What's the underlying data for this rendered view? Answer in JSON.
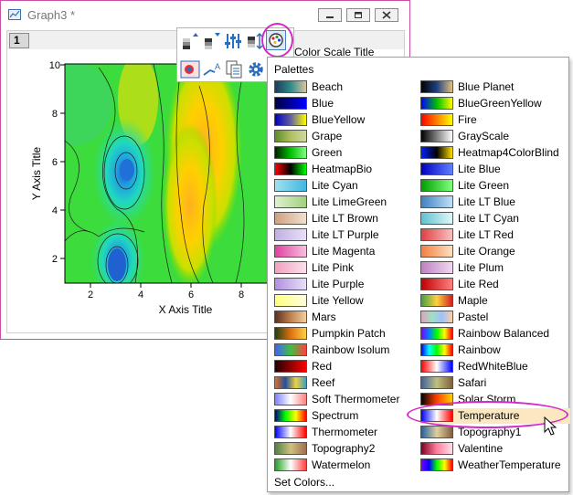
{
  "window": {
    "title": "Graph3 *",
    "layer_tab": "1"
  },
  "axes": {
    "xlabel": "X Axis Title",
    "ylabel": "Y Axis Title",
    "xticks": [
      "2",
      "4",
      "6",
      "8"
    ],
    "yticks": [
      "2",
      "4",
      "6",
      "8",
      "10"
    ]
  },
  "chart_data": {
    "type": "heatmap",
    "xlabel": "X Axis Title",
    "ylabel": "Y Axis Title",
    "xlim": [
      1,
      10
    ],
    "ylim": [
      1,
      10
    ],
    "x_ticks": [
      2,
      4,
      6,
      8
    ],
    "y_ticks": [
      2,
      4,
      6,
      8,
      10
    ]
  },
  "toolbar": {
    "partial_label": "Color Scale Title"
  },
  "menu": {
    "heading": "Palettes",
    "set_colors": "Set Colors...",
    "col1": [
      {
        "label": "Beach",
        "stops": [
          "#1d3b5a",
          "#2f8a8a",
          "#d8c6a0"
        ]
      },
      {
        "label": "Blue",
        "stops": [
          "#000040",
          "#0000ff"
        ]
      },
      {
        "label": "BlueYellow",
        "stops": [
          "#0000c0",
          "#6060a0",
          "#ffff00"
        ]
      },
      {
        "label": "Grape",
        "stops": [
          "#5c8c2a",
          "#b0c060",
          "#d0d8a0"
        ]
      },
      {
        "label": "Green",
        "stops": [
          "#002000",
          "#00c000",
          "#80ff80"
        ]
      },
      {
        "label": "HeatmapBio",
        "stops": [
          "#ff0000",
          "#000000",
          "#00ff00"
        ]
      },
      {
        "label": "Lite Cyan",
        "stops": [
          "#a0e0f0",
          "#40b8e0"
        ]
      },
      {
        "label": "Lite LimeGreen",
        "stops": [
          "#e0f0d0",
          "#a0d080"
        ]
      },
      {
        "label": "Lite LT Brown",
        "stops": [
          "#d0a080",
          "#f0e0d0"
        ]
      },
      {
        "label": "Lite LT Purple",
        "stops": [
          "#c0b0e0",
          "#e8e0f8"
        ]
      },
      {
        "label": "Lite Magenta",
        "stops": [
          "#e040a0",
          "#f8c0e0"
        ]
      },
      {
        "label": "Lite Pink",
        "stops": [
          "#f0a0c0",
          "#fce0ec"
        ]
      },
      {
        "label": "Lite Purple",
        "stops": [
          "#b090e0",
          "#e8e0f8"
        ]
      },
      {
        "label": "Lite Yellow",
        "stops": [
          "#ffff80",
          "#ffffe0"
        ]
      },
      {
        "label": "Mars",
        "stops": [
          "#5a3020",
          "#c08050",
          "#f0d0a0"
        ]
      },
      {
        "label": "Pumpkin Patch",
        "stops": [
          "#204010",
          "#e07010",
          "#ffd040"
        ]
      },
      {
        "label": "Rainbow Isolum",
        "stops": [
          "#4060ff",
          "#40c040",
          "#ff4040"
        ]
      },
      {
        "label": "Red",
        "stops": [
          "#200000",
          "#ff0000"
        ]
      },
      {
        "label": "Reef",
        "stops": [
          "#e07020",
          "#2050a0",
          "#f0d040",
          "#40a0c0"
        ]
      },
      {
        "label": "Soft Thermometer",
        "stops": [
          "#8080ff",
          "#ffffff",
          "#ff8080"
        ]
      },
      {
        "label": "Spectrum",
        "stops": [
          "#000080",
          "#00ff00",
          "#ffff00",
          "#ff0000"
        ]
      },
      {
        "label": "Thermometer",
        "stops": [
          "#0000ff",
          "#ffffff",
          "#ff0000"
        ]
      },
      {
        "label": "Topography2",
        "stops": [
          "#508040",
          "#d0c080",
          "#a07050"
        ]
      },
      {
        "label": "Watermelon",
        "stops": [
          "#20a020",
          "#ffffff",
          "#ff4040"
        ]
      }
    ],
    "col2": [
      {
        "label": "Blue Planet",
        "stops": [
          "#000000",
          "#204080",
          "#e0c080"
        ]
      },
      {
        "label": "BlueGreenYellow",
        "stops": [
          "#0000ff",
          "#00c000",
          "#ffff00"
        ]
      },
      {
        "label": "Fire",
        "stops": [
          "#ff0000",
          "#ff8000",
          "#ffff00"
        ]
      },
      {
        "label": "GrayScale",
        "stops": [
          "#000000",
          "#ffffff"
        ]
      },
      {
        "label": "Heatmap4ColorBlind",
        "stops": [
          "#0020ff",
          "#000000",
          "#ffe000"
        ]
      },
      {
        "label": "Lite Blue",
        "stops": [
          "#0000c0",
          "#6080ff"
        ]
      },
      {
        "label": "Lite Green",
        "stops": [
          "#00a000",
          "#80ff80"
        ]
      },
      {
        "label": "Lite LT Blue",
        "stops": [
          "#4080c0",
          "#c0e0f8"
        ]
      },
      {
        "label": "Lite LT Cyan",
        "stops": [
          "#60c0d0",
          "#e0f8f8"
        ]
      },
      {
        "label": "Lite LT Red",
        "stops": [
          "#e04040",
          "#f8c0c0"
        ]
      },
      {
        "label": "Lite Orange",
        "stops": [
          "#f08040",
          "#ffe0c0"
        ]
      },
      {
        "label": "Lite Plum",
        "stops": [
          "#c080c0",
          "#f0d8f0"
        ]
      },
      {
        "label": "Lite Red",
        "stops": [
          "#c00000",
          "#ff8080"
        ]
      },
      {
        "label": "Maple",
        "stops": [
          "#40a040",
          "#ffd040",
          "#d02020"
        ]
      },
      {
        "label": "Pastel",
        "stops": [
          "#e0a0c0",
          "#a0e0c0",
          "#a0c0ff",
          "#ffd0a0"
        ]
      },
      {
        "label": "Rainbow Balanced",
        "stops": [
          "#8000ff",
          "#0080ff",
          "#00ff00",
          "#ffff00",
          "#ff0000"
        ]
      },
      {
        "label": "Rainbow",
        "stops": [
          "#0000ff",
          "#00ffff",
          "#00ff00",
          "#ffff00",
          "#ff0000"
        ]
      },
      {
        "label": "RedWhiteBlue",
        "stops": [
          "#ff0000",
          "#ffffff",
          "#0000ff"
        ]
      },
      {
        "label": "Safari",
        "stops": [
          "#4060a0",
          "#c0c080",
          "#806040"
        ]
      },
      {
        "label": "Solar Storm",
        "stops": [
          "#000000",
          "#ff4000",
          "#ffd000"
        ]
      },
      {
        "label": "Temperature",
        "stops": [
          "#0000ff",
          "#ffffff",
          "#ff0000"
        ]
      },
      {
        "label": "Topography1",
        "stops": [
          "#2060a0",
          "#e0d0a0",
          "#806040"
        ]
      },
      {
        "label": "Valentine",
        "stops": [
          "#800020",
          "#ff80a0",
          "#ffe0e8"
        ]
      },
      {
        "label": "WeatherTemperature",
        "stops": [
          "#8000ff",
          "#0000ff",
          "#00ff00",
          "#ffff00",
          "#ff0000"
        ]
      }
    ],
    "selected": "Temperature"
  },
  "icons": {
    "app": "graph-window-icon",
    "minimize": "minimize-icon",
    "maximize": "maximize-icon",
    "close": "close-icon",
    "palette": "palette-icon",
    "cursor": "mouse-pointer-icon"
  }
}
